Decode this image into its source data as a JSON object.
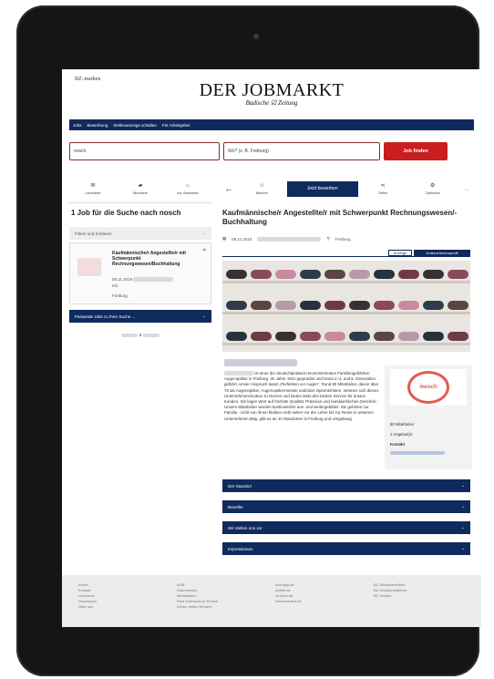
{
  "header": {
    "brand_small": "BZ–medien",
    "title": "DER JOBMARKT",
    "subtitle": "Badische ☑ Zeitung"
  },
  "nav": {
    "items": [
      "Jobs",
      "Bewerbung",
      "Stellenanzeige schalten",
      "Für Arbeitgeber"
    ]
  },
  "search": {
    "what_value": "nosch",
    "where_placeholder": "Wo? (z. B. Freiburg)",
    "submit_label": "Job finden"
  },
  "left_toolbar": [
    {
      "icon": "envelope-icon",
      "label": "Jobmailer"
    },
    {
      "icon": "folder-icon",
      "label": "Merkliste"
    },
    {
      "icon": "home-icon",
      "label": "zur Startseite"
    }
  ],
  "right_toolbar": {
    "merken": "Merken",
    "apply": "Jetzt bewerben",
    "share": "Teilen",
    "options": "Optionen"
  },
  "results": {
    "title": "1 Job für die Suche nach nosch",
    "filter_label": "Filtern und Sortieren",
    "card": {
      "title": "Kaufmännische/r Angestellte/r mit Schwerpunkt Rechnungswesen/Buchhaltung",
      "date": "09.11.2019",
      "kg": "KG",
      "city": "Freiburg"
    },
    "alert_label": "Passende Jobs zu Ihrer Suche ...",
    "pager_current": "1"
  },
  "detail": {
    "title": "Kaufmännische/r Angestellte/r mit Schwerpunkt Rechnungswesen/-Buchhaltung",
    "date": "09.11.2019",
    "city": "Freiburg",
    "tab_ad": "Anzeige",
    "tab_company": "Unternehmensprofil",
    "body": "ist einer der deutschlandweit renommiertesten Familiengeführten Augenoptiker in Freiburg. Im Jahre 1911 gegründet und heute in 4. und 5. Generation geführt. Unser Anspruch lautet „Perfektion vor Augen“. Rund 80 Mitarbeiter, davon über 70 als Augenoptiker, Augenoptikermeister und/oder Optometristen, nehmen sich dieses Unternehmensmottos zu Herzen und bieten stets den besten Service für unsere Kunden. Wir legen Wert auf höchste Qualität, Präzision und handwerkliches Geschick. Unsere Mitarbeiter werden kontinuierlich aus- und weitergebildet. Sie gehören zur Familie - nicht von ihnen bleiben nicht selten vor der Lehre bis zur Rente in unserem Unternehmen tätig. gibt es an 10 Standorten in Freiburg und Umgebung.",
    "company_logo_text": "mosch",
    "company_staff": "80 Mitarbeiter",
    "company_offers": "1 Angebot(e)",
    "company_contact": "Kontakt"
  },
  "accordion": [
    "Der Standort",
    "Benefits",
    "Wir stellen uns vor",
    "Impressionen"
  ],
  "footer": {
    "col1": [
      "Archiv",
      "Kontakt",
      "Leserbrief",
      "Impressum",
      "Über uns"
    ],
    "col2": [
      "AGB",
      "Datenschutz",
      "Mediadaten",
      "Radl Datenschutz Presse",
      "Kinder helfen Kindern"
    ],
    "col3": [
      "schnapp.de",
      "fudder.de",
      "zu-tisch.de",
      "meinverband.de"
    ],
    "col4": [
      "BZ-Straussenführer",
      "BZ-Restaurantführer",
      "BZ-Veseler"
    ]
  },
  "colors": {
    "navy": "#0f2a5c",
    "accent_red": "#c81e1e"
  }
}
